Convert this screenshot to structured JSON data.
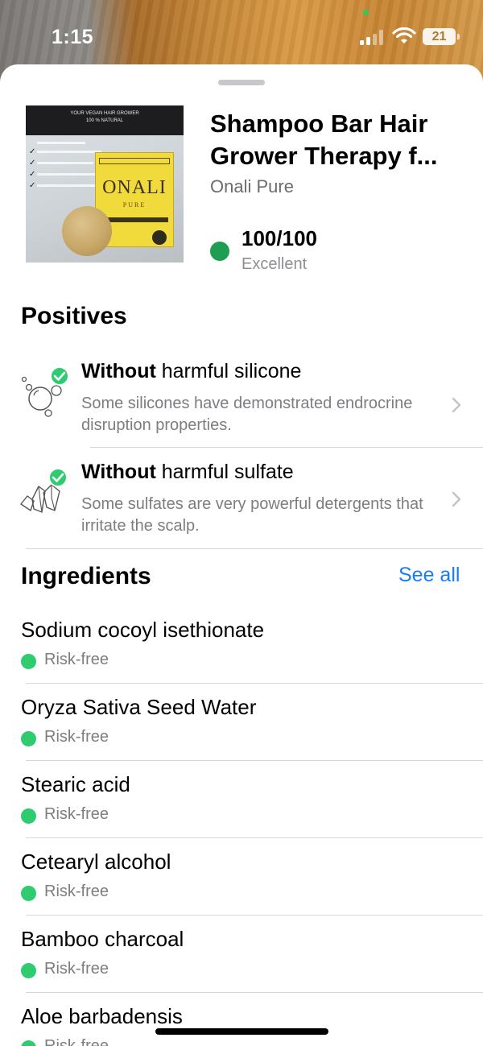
{
  "status_bar": {
    "time": "1:15",
    "battery": "21",
    "privacy_indicator_color": "#34c759"
  },
  "product": {
    "title_line1": "Shampoo Bar Hair",
    "title_line2": "Grower Therapy f...",
    "brand": "Onali Pure",
    "score": "100/100",
    "score_label": "Excellent",
    "score_color": "#1e9e53",
    "image": {
      "banner_line1": "YOUR VEGAN HAIR GROWER",
      "banner_line2": "100 % NATURAL",
      "box_brand": "ONALI",
      "box_sub": "PURE"
    }
  },
  "positives": {
    "title": "Positives",
    "items": [
      {
        "icon": "bubbles-icon",
        "bold": "Without",
        "rest": " harmful silicone",
        "description": "Some silicones have demonstrated endrocrine disruption properties."
      },
      {
        "icon": "crystals-icon",
        "bold": "Without",
        "rest": " harmful sulfate",
        "description": "Some sulfates are very powerful detergents that irritate the scalp."
      }
    ]
  },
  "ingredients": {
    "title": "Ingredients",
    "see_all": "See all",
    "risk_color": "#2ecc71",
    "items": [
      {
        "name": "Sodium cocoyl isethionate",
        "status": "Risk-free"
      },
      {
        "name": "Oryza Sativa Seed Water",
        "status": "Risk-free"
      },
      {
        "name": "Stearic acid",
        "status": "Risk-free"
      },
      {
        "name": "Cetearyl alcohol",
        "status": "Risk-free"
      },
      {
        "name": "Bamboo charcoal",
        "status": "Risk-free"
      },
      {
        "name": "Aloe barbadensis",
        "status": "Risk-free"
      }
    ]
  }
}
